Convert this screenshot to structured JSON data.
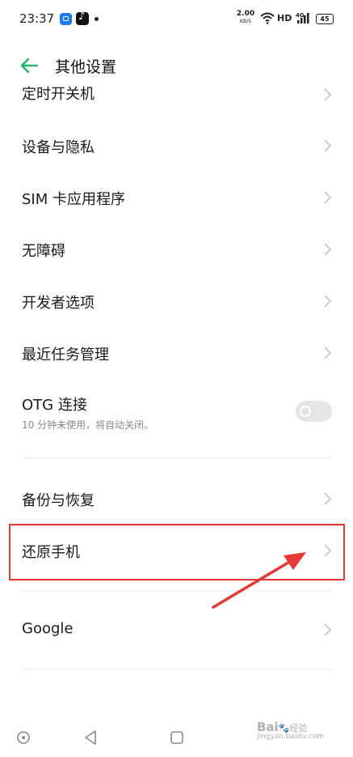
{
  "status_bar": {
    "time": "23:37",
    "speed_value": "2.00",
    "speed_unit": "KB/S",
    "network_label": "HD",
    "signal_label": "4G",
    "battery": "45"
  },
  "header": {
    "title": "其他设置",
    "back_icon": "arrow-left-icon",
    "accent_color": "#23b36b"
  },
  "settings": {
    "partial_item": "定时开关机",
    "items": [
      {
        "label": "设备与隐私"
      },
      {
        "label": "SIM 卡应用程序"
      },
      {
        "label": "无障碍"
      },
      {
        "label": "开发者选项"
      },
      {
        "label": "最近任务管理"
      }
    ],
    "otg": {
      "label": "OTG 连接",
      "description": "10 分钟未使用，将自动关闭。",
      "enabled": false
    },
    "backup": {
      "label": "备份与恢复"
    },
    "reset": {
      "label": "还原手机"
    },
    "google": {
      "label": "Google"
    }
  },
  "annotation": {
    "highlight_color": "#e53935"
  },
  "nav_bar": {
    "buttons": [
      "menu-circle-icon",
      "back-triangle-icon",
      "home-square-icon"
    ]
  },
  "watermark": {
    "brand": "Bai",
    "suffix": "经验",
    "url": "jingyan.baidu.com"
  }
}
